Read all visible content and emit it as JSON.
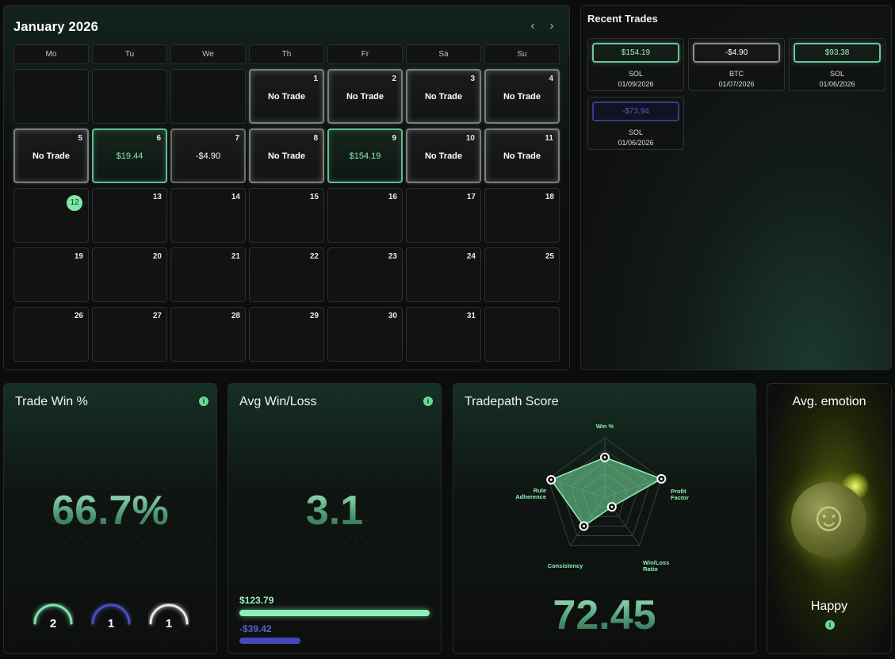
{
  "calendar": {
    "title": "January 2026",
    "prev_icon": "‹",
    "next_icon": "›",
    "weekdays": [
      "Mo",
      "Tu",
      "We",
      "Th",
      "Fr",
      "Sa",
      "Su"
    ],
    "weeks": [
      [
        {
          "day": "",
          "label": "",
          "kind": "empty"
        },
        {
          "day": "",
          "label": "",
          "kind": "empty"
        },
        {
          "day": "",
          "label": "",
          "kind": "empty"
        },
        {
          "day": "1",
          "label": "No Trade",
          "kind": "nt"
        },
        {
          "day": "2",
          "label": "No Trade",
          "kind": "nt"
        },
        {
          "day": "3",
          "label": "No Trade",
          "kind": "nt"
        },
        {
          "day": "4",
          "label": "No Trade",
          "kind": "nt"
        }
      ],
      [
        {
          "day": "5",
          "label": "No Trade",
          "kind": "nt"
        },
        {
          "day": "6",
          "label": "$19.44",
          "kind": "win"
        },
        {
          "day": "7",
          "label": "-$4.90",
          "kind": "loss"
        },
        {
          "day": "8",
          "label": "No Trade",
          "kind": "nt"
        },
        {
          "day": "9",
          "label": "$154.19",
          "kind": "win"
        },
        {
          "day": "10",
          "label": "No Trade",
          "kind": "nt"
        },
        {
          "day": "11",
          "label": "No Trade",
          "kind": "nt"
        }
      ],
      [
        {
          "day": "12",
          "label": "",
          "kind": "today"
        },
        {
          "day": "13",
          "label": "",
          "kind": "plain"
        },
        {
          "day": "14",
          "label": "",
          "kind": "plain"
        },
        {
          "day": "15",
          "label": "",
          "kind": "plain"
        },
        {
          "day": "16",
          "label": "",
          "kind": "plain"
        },
        {
          "day": "17",
          "label": "",
          "kind": "plain"
        },
        {
          "day": "18",
          "label": "",
          "kind": "plain"
        }
      ],
      [
        {
          "day": "19",
          "label": "",
          "kind": "plain"
        },
        {
          "day": "20",
          "label": "",
          "kind": "plain"
        },
        {
          "day": "21",
          "label": "",
          "kind": "plain"
        },
        {
          "day": "22",
          "label": "",
          "kind": "plain"
        },
        {
          "day": "23",
          "label": "",
          "kind": "plain"
        },
        {
          "day": "24",
          "label": "",
          "kind": "plain"
        },
        {
          "day": "25",
          "label": "",
          "kind": "plain"
        }
      ],
      [
        {
          "day": "26",
          "label": "",
          "kind": "plain"
        },
        {
          "day": "27",
          "label": "",
          "kind": "plain"
        },
        {
          "day": "28",
          "label": "",
          "kind": "plain"
        },
        {
          "day": "29",
          "label": "",
          "kind": "plain"
        },
        {
          "day": "30",
          "label": "",
          "kind": "plain"
        },
        {
          "day": "31",
          "label": "",
          "kind": "plain"
        },
        {
          "day": "",
          "label": "",
          "kind": "plain"
        }
      ]
    ]
  },
  "recent_trades": {
    "title": "Recent Trades",
    "items": [
      {
        "amount": "$154.19",
        "symbol": "SOL",
        "date": "01/09/2026",
        "kind": "w"
      },
      {
        "amount": "-$4.90",
        "symbol": "BTC",
        "date": "01/07/2026",
        "kind": "n"
      },
      {
        "amount": "$93.38",
        "symbol": "SOL",
        "date": "01/06/2026",
        "kind": "w"
      },
      {
        "amount": "-$73.94",
        "symbol": "SOL",
        "date": "01/06/2026",
        "kind": "l"
      }
    ]
  },
  "trade_win": {
    "title": "Trade Win %",
    "info_icon": "i",
    "value": "66.7%",
    "rings": [
      {
        "count": "2",
        "color": "#7fe0a8",
        "fraction": 0.5
      },
      {
        "count": "1",
        "color": "#4a4fc0",
        "fraction": 0.5
      },
      {
        "count": "1",
        "color": "#e6e6e6",
        "fraction": 0.5
      }
    ]
  },
  "avg_win_loss": {
    "title": "Avg Win/Loss",
    "info_icon": "i",
    "value": "3.1",
    "avg_win": "$123.79",
    "avg_loss": "-$39.42",
    "win_fraction": 1.0,
    "loss_fraction": 0.32,
    "win_color": "#8cf0b6",
    "loss_color": "#4448b8"
  },
  "tradepath": {
    "title": "Tradepath Score",
    "value": "72.45",
    "axes": [
      "Win %",
      "Profit\nFactor",
      "Win/Loss\nRatio",
      "Consistency",
      "Rule\nAdherence"
    ],
    "scores": [
      0.67,
      1.0,
      0.2,
      0.6,
      0.95
    ]
  },
  "emotion": {
    "title": "Avg. emotion",
    "label": "Happy",
    "info_icon": "i",
    "face_icon": "☺"
  },
  "colors": {
    "accent": "#7ee8a6",
    "loss": "#4a4fc0"
  }
}
